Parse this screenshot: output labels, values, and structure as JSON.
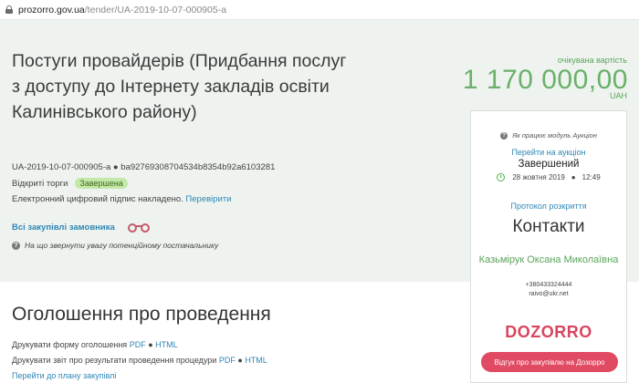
{
  "browser": {
    "url_domain": "prozorro.gov.ua",
    "url_path": "/tender/UA-2019-10-07-000905-a"
  },
  "tender": {
    "title": "Постуги провайдерів (Придбання послуг з доступу до Інтернету закладів освіти Калинівського району)",
    "id_line": "UA-2019-10-07-000905-a ● ba92769308704534b8354b92a6103281",
    "procedure": "Відкриті торги",
    "status_badge": "Завершена",
    "signature_text": "Електронний цифровий підпис накладено.",
    "signature_link": "Перевірити",
    "buyer_link": "Всі закупівлі замовника",
    "attention_text": "На що звернути увагу потенційному постачальнику"
  },
  "price": {
    "label": "очікувана вартість",
    "value": "1 170 000,00",
    "currency": "UAH"
  },
  "auction_card": {
    "how_it_works": "Як працює модуль Аукціон",
    "goto_auction": "Перейти на аукціон",
    "status": "Завершений",
    "date": "28 жовтня 2019",
    "time": "12:49",
    "protocol": "Протокол розкриття",
    "contacts_title": "Контакти",
    "contact_name": "Казьмірук Оксана Миколаївна",
    "phone": "+380433324444",
    "email": "raivo@ukr.net",
    "dozorro_logo": "DOZORRO",
    "review_button": "Відгук про закупівлю на Дозорро"
  },
  "announcement": {
    "title": "Оголошення про проведення",
    "print_form": "Друкувати форму оголошення",
    "print_report": "Друкувати звіт про результати проведення процедури",
    "pdf": "PDF",
    "html": "HTML",
    "sep": "●",
    "plan_link": "Перейти до плану закупівлі"
  },
  "icons": [
    "lock-icon",
    "binoculars-icon",
    "question-icon",
    "clock-icon"
  ],
  "colors": {
    "band_bg": "#eef3ef",
    "link": "#2e86b5",
    "price_green": "#6ab06a",
    "accent_red": "#e04a62"
  }
}
